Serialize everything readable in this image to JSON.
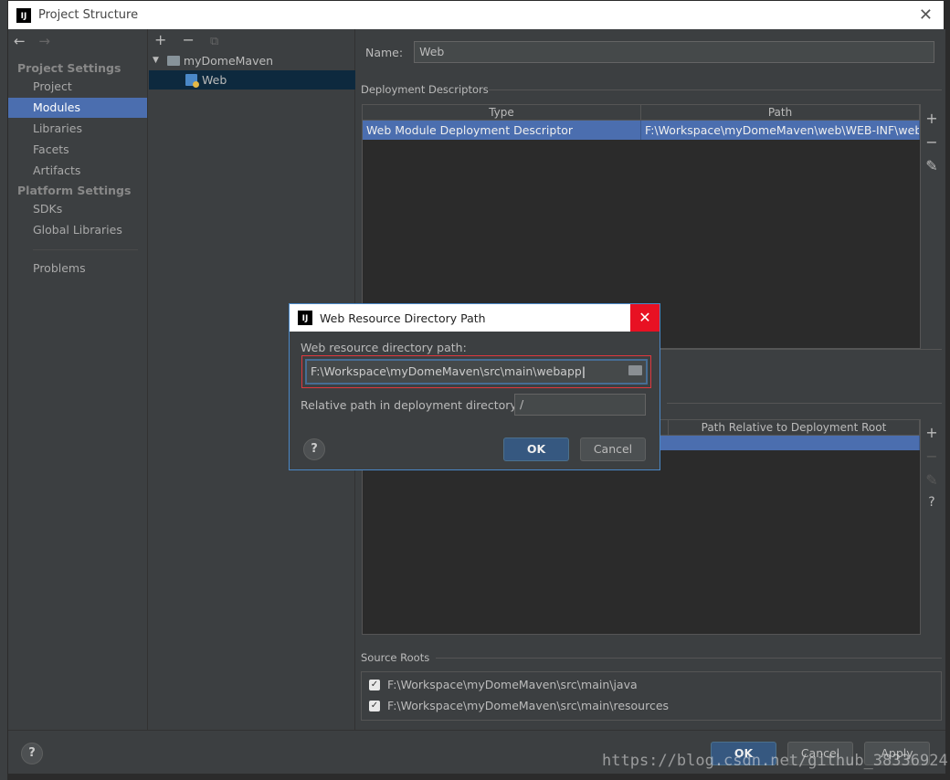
{
  "window": {
    "title": "Project Structure",
    "close_glyph": "✕"
  },
  "nav": {
    "back_glyph": "←",
    "forward_glyph": "→",
    "project_settings_header": "Project Settings",
    "platform_settings_header": "Platform Settings",
    "items": {
      "project": "Project",
      "modules": "Modules",
      "libraries": "Libraries",
      "facets": "Facets",
      "artifacts": "Artifacts",
      "sdks": "SDKs",
      "global_libraries": "Global Libraries",
      "problems": "Problems"
    }
  },
  "tree": {
    "add_glyph": "+",
    "remove_glyph": "−",
    "copy_glyph": "⧉",
    "expand_glyph": "▼",
    "root": "myDomeMaven",
    "child": "Web"
  },
  "facet": {
    "name_label": "Name:",
    "name_value": "Web",
    "deployment_descriptors_label": "Deployment Descriptors",
    "descriptors_columns": [
      "Type",
      "Path"
    ],
    "descriptors_rows": [
      {
        "type": "Web Module Deployment Descriptor",
        "path": "F:\\Workspace\\myDomeMaven\\web\\WEB-INF\\web.x"
      }
    ],
    "resources_column": "Path Relative to Deployment Root",
    "source_roots_label": "Source Roots",
    "source_roots": [
      "F:\\Workspace\\myDomeMaven\\src\\main\\java",
      "F:\\Workspace\\myDomeMaven\\src\\main\\resources"
    ],
    "tool_add": "+",
    "tool_remove": "−",
    "tool_edit": "✎",
    "tool_help": "?"
  },
  "footer": {
    "help": "?",
    "ok": "OK",
    "cancel": "Cancel",
    "apply": "Apply"
  },
  "dialog": {
    "title": "Web Resource Directory Path",
    "close_glyph": "✕",
    "path_label": "Web resource directory path:",
    "path_value": "F:\\Workspace\\myDomeMaven\\src\\main\\webapp",
    "relative_label": "Relative path in deployment directory:",
    "relative_value": "/",
    "help": "?",
    "ok": "OK",
    "cancel": "Cancel"
  },
  "watermark": "https://blog.csdn.net/github_38336924",
  "colors": {
    "selection": "#4b6eaf",
    "dialog_close": "#e81123",
    "highlight_box": "#e0383e",
    "primary_button": "#365880"
  },
  "icons": [
    "ij-logo-icon",
    "folder-icon",
    "web-module-icon",
    "folder-open-icon",
    "checkbox-icon"
  ]
}
